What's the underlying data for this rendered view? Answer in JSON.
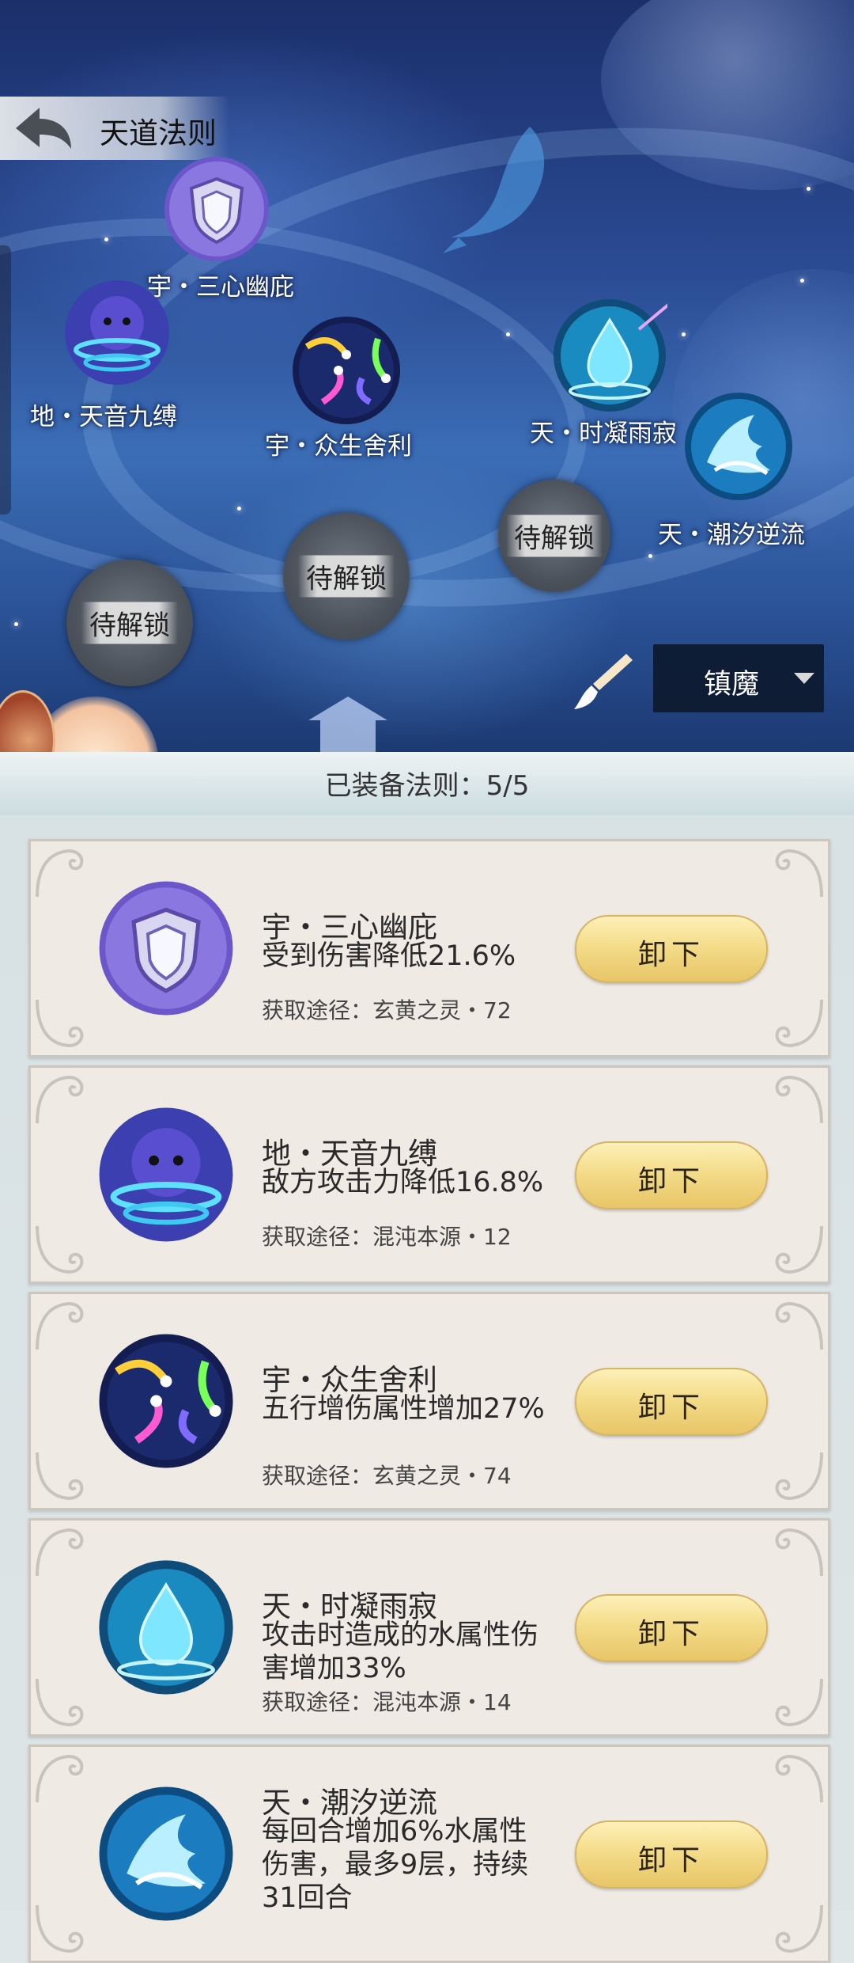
{
  "header": {
    "title": "天道法则"
  },
  "map": {
    "nodes": [
      {
        "label": "宇・三心幽庇",
        "icon": "shield-rune-icon"
      },
      {
        "label": "地・天音九缚",
        "icon": "spirit-vortex-icon"
      },
      {
        "label": "宇・众生舍利",
        "icon": "colorful-comets-icon"
      },
      {
        "label": "天・时凝雨寂",
        "icon": "water-drop-icon"
      },
      {
        "label": "天・潮汐逆流",
        "icon": "tide-wave-icon"
      }
    ],
    "locked": [
      {
        "label": "待解锁"
      },
      {
        "label": "待解锁"
      },
      {
        "label": "待解锁"
      }
    ]
  },
  "mode_select": {
    "value": "镇魔"
  },
  "equipped": {
    "label": "已装备法则：5/5"
  },
  "cards": [
    {
      "name": "宇・三心幽庇",
      "desc": "受到伤害降低21.6%",
      "source": "获取途径：玄黄之灵・72",
      "button": "卸下",
      "icon": "shield-rune-icon",
      "accent": "#6a55c8"
    },
    {
      "name": "地・天音九缚",
      "desc": "敌方攻击力降低16.8%",
      "source": "获取途径：混沌本源・12",
      "button": "卸下",
      "icon": "spirit-vortex-icon",
      "accent": "#3b49b8"
    },
    {
      "name": "宇・众生舍利",
      "desc": "五行增伤属性增加27%",
      "source": "获取途径：玄黄之灵・74",
      "button": "卸下",
      "icon": "colorful-comets-icon",
      "accent": "#1b2a6c"
    },
    {
      "name": "天・时凝雨寂",
      "desc": "攻击时造成的水属性伤害增加33%",
      "source": "获取途径：混沌本源・14",
      "button": "卸下",
      "icon": "water-drop-icon",
      "accent": "#1a8bc0"
    },
    {
      "name": "天・潮汐逆流",
      "desc": "每回合增加6%水属性伤害，最多9层，持续31回合",
      "source": "",
      "button": "卸下",
      "icon": "tide-wave-icon",
      "accent": "#1b7cc0"
    }
  ]
}
